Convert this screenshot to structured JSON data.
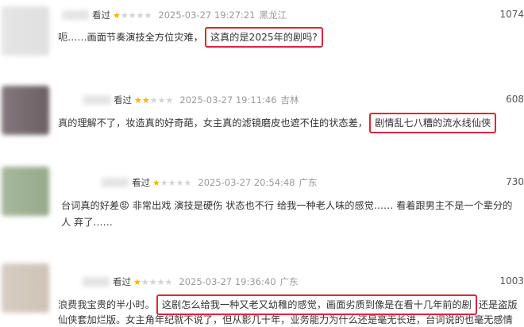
{
  "reviews": [
    {
      "status": "看过",
      "rating": 1,
      "time": "2025-03-27 19:27:21",
      "location": "黑龙江",
      "votes": "1074",
      "lines": [
        {
          "before": "呃……画面节奏演技全方位灾难，",
          "highlight": "这真的是2025年的剧吗?",
          "after": ""
        }
      ]
    },
    {
      "status": "看过",
      "rating": 2,
      "time": "2025-03-27 19:11:46",
      "location": "吉林",
      "votes": "608",
      "lines": [
        {
          "before": "真的理解不了，妆造真的好奇葩，女主真的滤镜磨皮也遮不住的状态差，",
          "highlight": "剧情乱七八糟的流水线仙侠",
          "after": ""
        }
      ]
    },
    {
      "status": "看过",
      "rating": 1,
      "time": "2025-03-27 20:54:48",
      "location": "广东",
      "votes": "730",
      "lines": [
        {
          "before": "台词真的好差😡 非常出戏 演技是硬伤 状态也不行 给我一种老人味的感觉…… 看着跟男主不是一个辈分的",
          "highlight": "",
          "after": ""
        },
        {
          "before": "人 弃了……",
          "highlight": "",
          "after": ""
        }
      ]
    },
    {
      "status": "看过",
      "rating": 1,
      "time": "2025-03-27 19:36:40",
      "location": "广东",
      "votes": "1003",
      "lines": [
        {
          "before": "浪费我宝贵的半小时。",
          "highlight": "这剧怎么给我一种又老又幼稚的感觉，画面劣质到像是在看十几年前的剧",
          "after": "还是盗版"
        },
        {
          "before": "仙侠套加烂版。女主角年纪就不说了，但从影几十年，业务能力为什么还是毫无长进，台词说的也毫无感情",
          "highlight": "",
          "after": ""
        }
      ]
    }
  ],
  "colors": {
    "star_on": "#f4b400",
    "star_off": "#d3d3d3",
    "highlight_border": "#d9283b",
    "meta_gray": "#9a9a9a",
    "avatar_tones": [
      "#dcdcdc",
      "#5a4c52",
      "#8aa07c",
      "#c9bcae"
    ]
  }
}
